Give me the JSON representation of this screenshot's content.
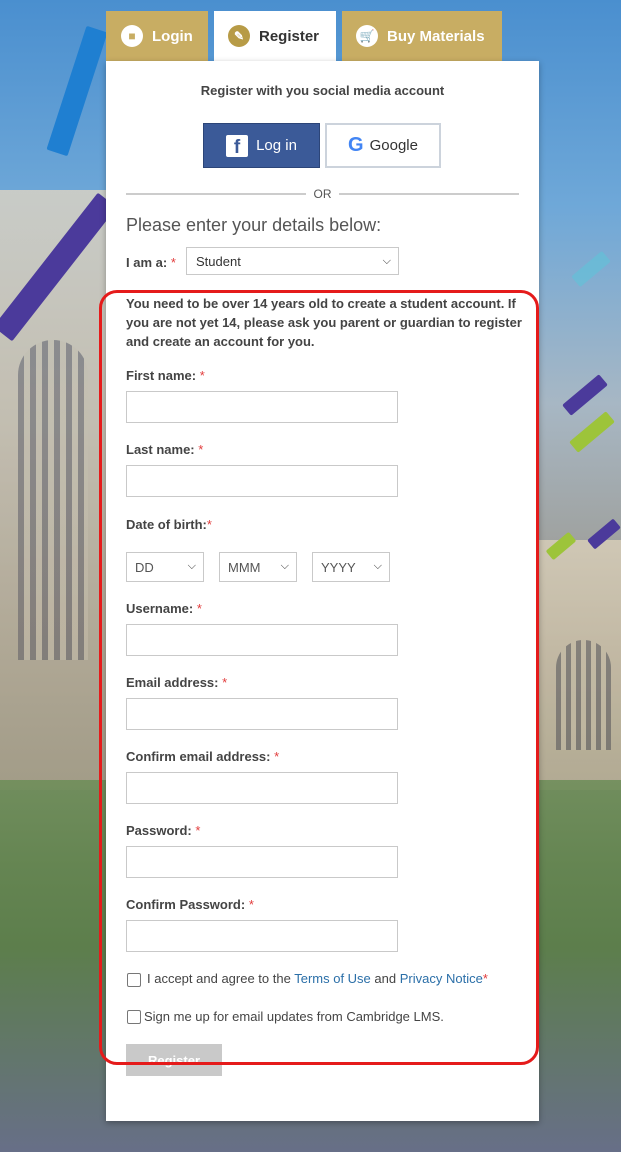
{
  "tabs": {
    "login": "Login",
    "register": "Register",
    "buy": "Buy Materials"
  },
  "social": {
    "title": "Register with you social media account",
    "facebook_label": "Log in",
    "google_label": "Google",
    "or_text": "OR"
  },
  "form": {
    "heading": "Please enter your details below:",
    "iam_label": "I am a:",
    "role_value": "Student",
    "notice": "You need to be over 14 years old to create a student account. If you are not yet 14, please ask you parent or guardian to register and create an account for you.",
    "first_name": "First name:",
    "last_name": "Last name:",
    "dob": "Date of birth:",
    "dob_day": "DD",
    "dob_month": "MMM",
    "dob_year": "YYYY",
    "username": "Username:",
    "email": "Email address:",
    "confirm_email": "Confirm email address:",
    "password": "Password:",
    "confirm_password": "Confirm Password:",
    "terms_prefix": "I accept and agree to the",
    "terms_link": "Terms of Use",
    "and": "and",
    "privacy_link": "Privacy Notice",
    "newsletter": "Sign me up for email updates from Cambridge LMS.",
    "register_button": "Register",
    "required_mark": "*"
  },
  "colors": {
    "tab_gold": "#c8ad63",
    "facebook_blue": "#3b5a98",
    "highlight_red": "#e51b1b",
    "link_blue": "#2b6fa8"
  }
}
